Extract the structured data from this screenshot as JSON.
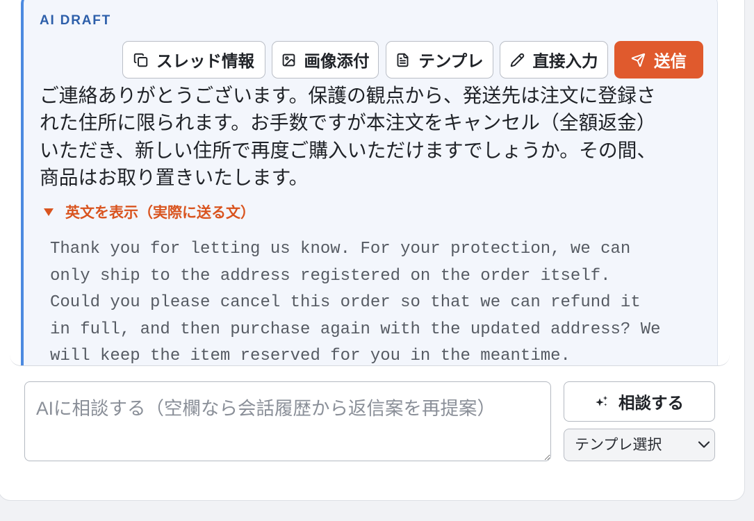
{
  "draft": {
    "label": "AI DRAFT",
    "actions": {
      "thread_info": "スレッド情報",
      "attach_image": "画像添付",
      "template": "テンプレ",
      "direct_input": "直接入力",
      "send": "送信"
    },
    "body_ja": "ご連絡ありがとうございます。保護の観点から、発送先は注文に登録された住所に限られます。お手数ですが本注文をキャンセル（全額返金）いただき、新しい住所で再度ご購入いただけますでしょうか。その間、商品はお取り置きいたします。",
    "english_toggle": {
      "label": "英文を表示（実際に送る文）",
      "expanded": true
    },
    "body_en": "Thank you for letting us know. For your protection, we can only ship to the address registered on the order itself. Could you please cancel this order so that we can refund it in full, and then purchase again with the updated address? We will keep the item reserved for you in the meantime."
  },
  "composer": {
    "value": "",
    "placeholder": "AIに相談する（空欄なら会話履歴から返信案を再提案）",
    "consult_label": "相談する",
    "template_select": {
      "selected": "テンプレ選択"
    }
  },
  "icons": {
    "thread_info": "copy-icon",
    "attach_image": "image-icon",
    "template": "file-text-icon",
    "direct_input": "pencil-icon",
    "send": "send-icon",
    "english_toggle": "triangle-down-icon",
    "consult": "sparkles-icon",
    "template_select": "chevron-down-icon"
  },
  "colors": {
    "draft_accent": "#4c8ae0",
    "draft_label": "#2d5faa",
    "send_button": "#e05a2d",
    "disclosure": "#d9541f"
  }
}
